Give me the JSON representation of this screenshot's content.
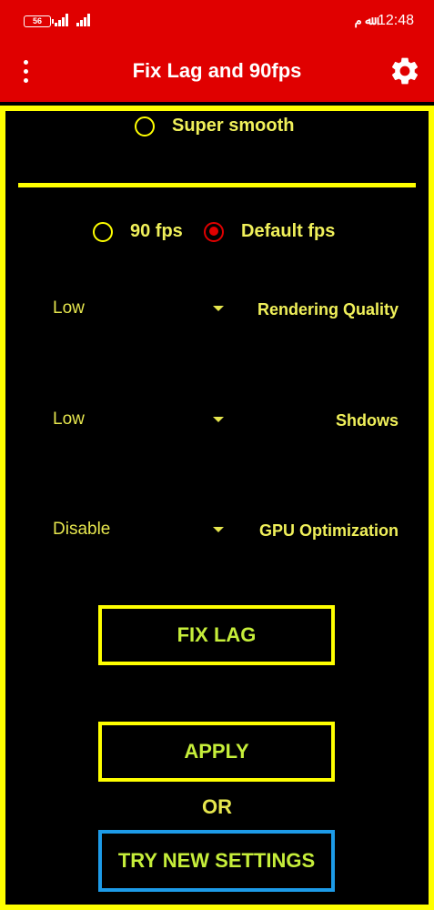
{
  "status_bar": {
    "battery": "56",
    "carrier_glyph": "ﷲ م",
    "time": "12:48"
  },
  "app_bar": {
    "title": "Fix Lag and 90fps",
    "menu_icon": "more-vert-icon",
    "settings_icon": "gear-icon"
  },
  "options": {
    "super_smooth": {
      "label": "Super smooth",
      "checked": false
    },
    "fps_90": {
      "label": "90 fps",
      "checked": false
    },
    "default_fps": {
      "label": "Default fps",
      "checked": true
    }
  },
  "settings": [
    {
      "value": "Low",
      "label": "Rendering Quality"
    },
    {
      "value": "Low",
      "label": "Shdows"
    },
    {
      "value": "Disable",
      "label": "GPU Optimization"
    }
  ],
  "buttons": {
    "fix_lag": "FIX LAG",
    "apply": "APPLY",
    "or": "OR",
    "try_new": "TRY NEW SETTINGS"
  },
  "colors": {
    "bar": "#e00000",
    "border": "#ffff00",
    "text": "#f0f05a",
    "button_text": "#c6ee3a",
    "accent_blue": "#1d9be8"
  }
}
